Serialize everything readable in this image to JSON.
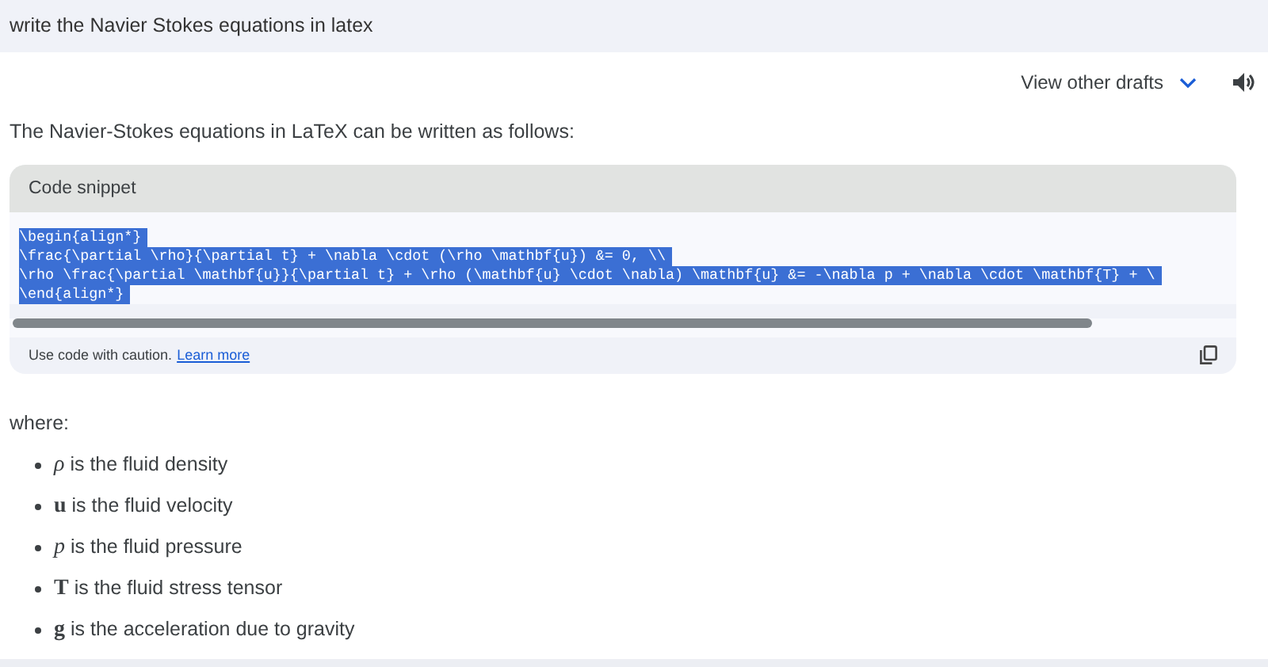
{
  "prompt": {
    "text": "write the Navier Stokes equations in latex"
  },
  "drafts": {
    "label": "View other drafts"
  },
  "intro": "The Navier-Stokes equations in LaTeX can be written as follows:",
  "code_block": {
    "title": "Code snippet",
    "selected": true,
    "lines": [
      "\\begin{align*}",
      "\\frac{\\partial \\rho}{\\partial t} + \\nabla \\cdot (\\rho \\mathbf{u}) &= 0, \\\\",
      "\\rho \\frac{\\partial \\mathbf{u}}{\\partial t} + \\rho (\\mathbf{u} \\cdot \\nabla) \\mathbf{u} &= -\\nabla p + \\nabla \\cdot \\mathbf{T} + \\",
      "\\end{align*}"
    ],
    "caution": "Use code with caution.",
    "link": "Learn more"
  },
  "where": "where:",
  "bullets": [
    {
      "text": "*ρ* is the fluid density"
    },
    {
      "text": "**u** is the fluid velocity"
    },
    {
      "text": "*p* is the fluid pressure"
    },
    {
      "text": "**T** is the fluid stress tensor"
    },
    {
      "text": "**g** is the acceleration due to gravity"
    }
  ]
}
